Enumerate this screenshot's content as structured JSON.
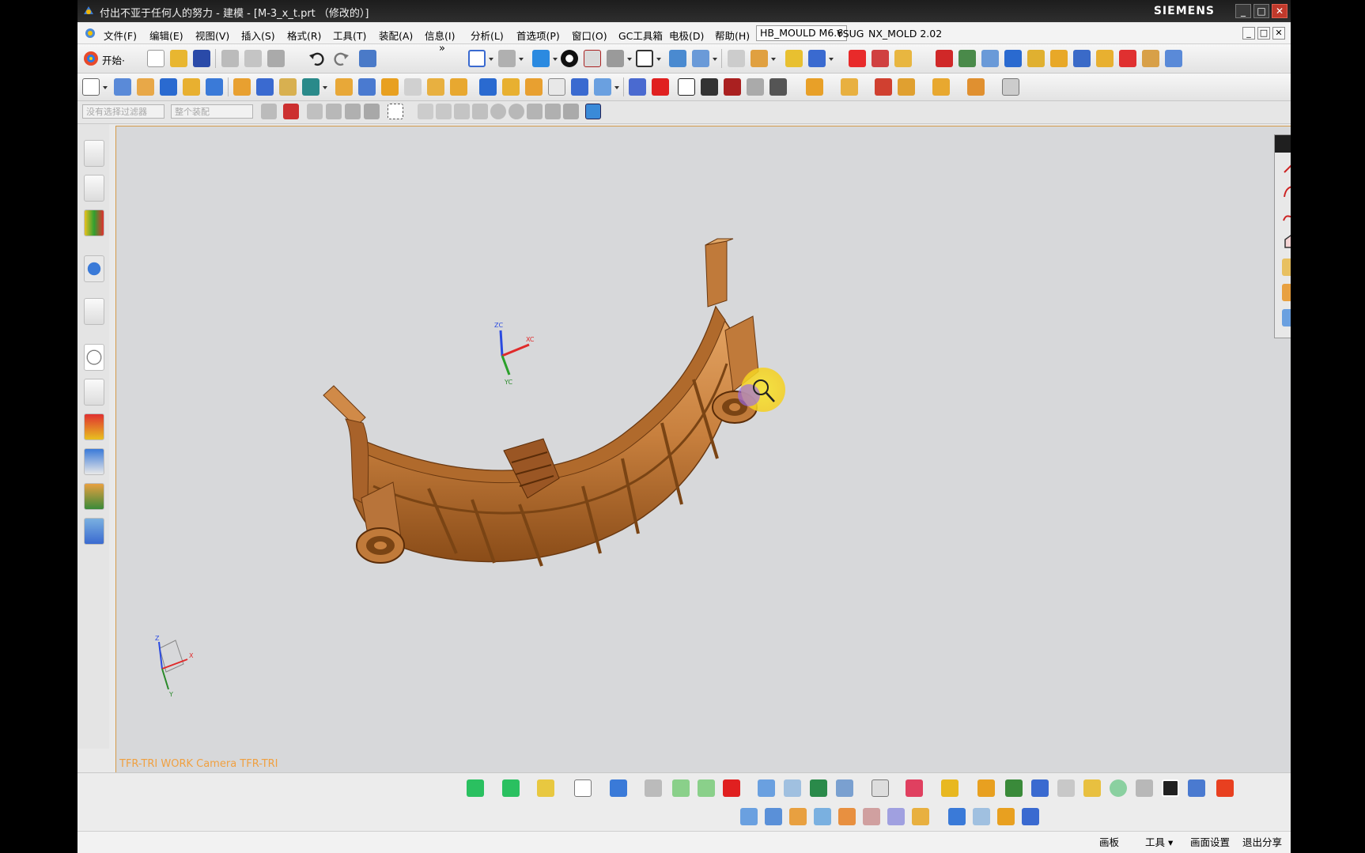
{
  "window": {
    "title": "付出不亚于任何人的努力 - 建模 - [M-3_x_t.prt （修改的）]",
    "brand": "SIEMENS",
    "controls": {
      "minimize": "_",
      "maximize": "□",
      "close": "✕"
    }
  },
  "menu": {
    "items": [
      "文件(F)",
      "编辑(E)",
      "视图(V)",
      "插入(S)",
      "格式(R)",
      "工具(T)",
      "装配(A)",
      "信息(I)",
      "分析(L)",
      "首选项(P)",
      "窗口(O)",
      "GC工具箱",
      "电极(D)",
      "帮助(H)"
    ],
    "addons": [
      "HB_MOULD M6.6",
      "YSUG",
      "NX_MOLD 2.02"
    ]
  },
  "toolbar": {
    "start_label": "开始·",
    "overflow": "»"
  },
  "selection": {
    "filter_placeholder": "没有选择过滤器",
    "assembly_placeholder": "整个装配"
  },
  "viewport": {
    "caption": "TFR-TRI WORK Camera TFR-TRI",
    "axes": {
      "z": "ZC",
      "x": "XC",
      "y": "YC"
    },
    "triad": {
      "z": "Z",
      "x": "X",
      "y": "Y"
    }
  },
  "colors": {
    "part": "#c8803e",
    "part_dark": "#7a4414",
    "part_light": "#e6a766",
    "viewport_bg": "#d7d8da",
    "palette": [
      "#e8261c",
      "#f2ec1c",
      "#2cc22c",
      "#1f2ae0",
      "#1fd8ea",
      "#e81fe0",
      "#111111",
      "#ffffff"
    ]
  },
  "status_bar": {
    "buttons": [
      "画板",
      "工具 ▾",
      "画面设置",
      "退出分享"
    ]
  }
}
